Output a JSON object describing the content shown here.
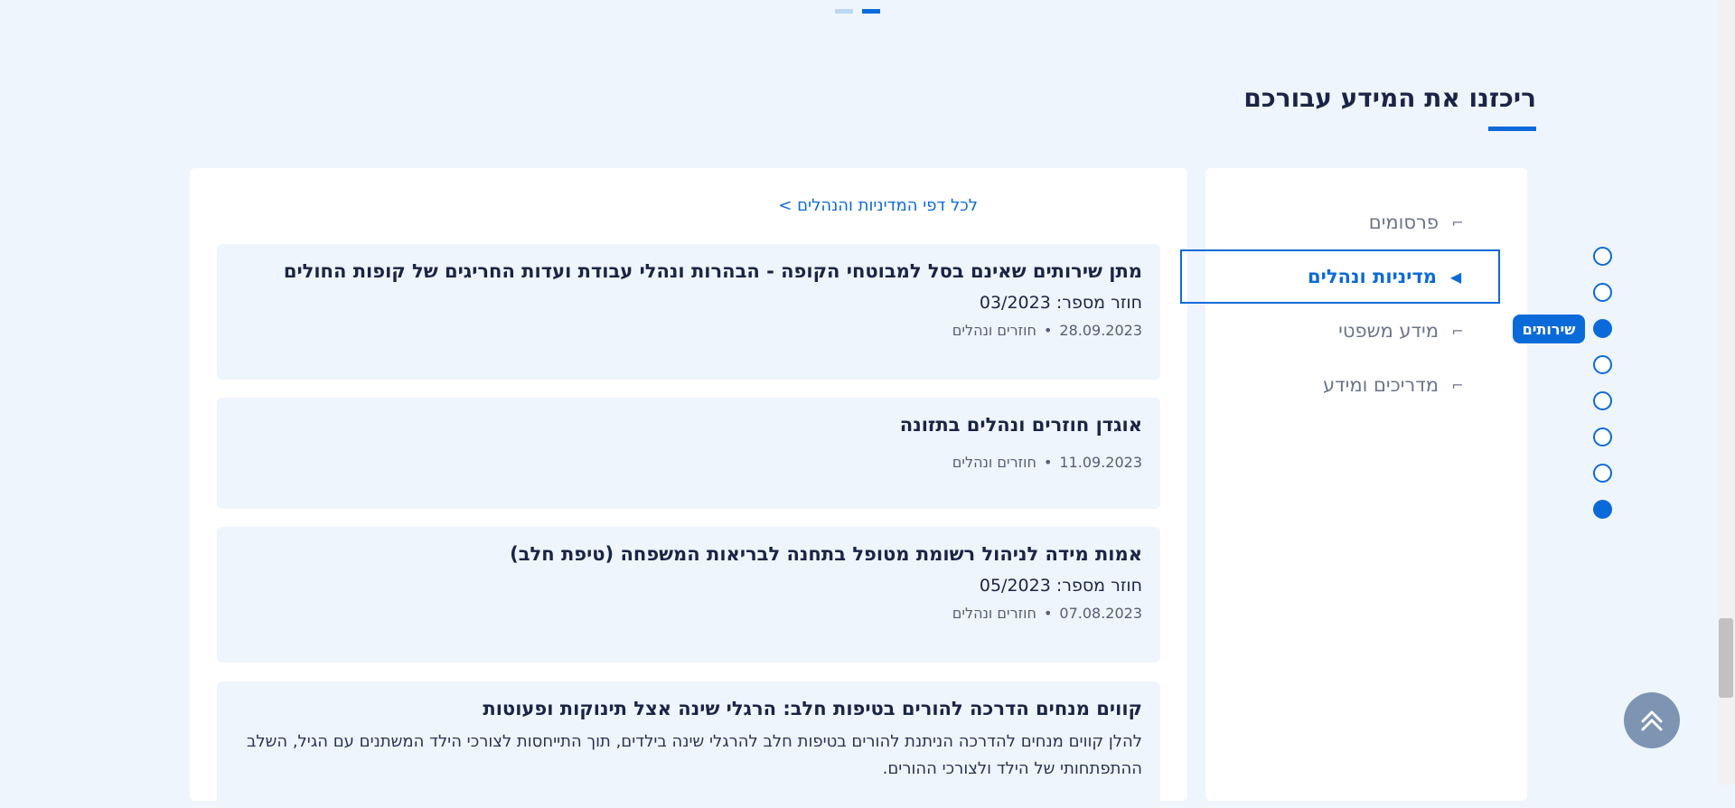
{
  "carousel": {
    "dots": 2,
    "active_index": 1
  },
  "section": {
    "title": "ריכזנו את המידע עבורכם"
  },
  "content": {
    "all_link": "לכל דפי המדיניות והנהלים >",
    "items": [
      {
        "title": "מתן שירותים שאינם בסל למבוטחי הקופה - הבהרות ונהלי עבודת ועדות החריגים של קופות החולים",
        "number": "חוזר מספר: 03/2023",
        "date": "28.09.2023",
        "category": "חוזרים ונהלים"
      },
      {
        "title": "אוגדן חוזרים ונהלים בתזונה",
        "date": "11.09.2023",
        "category": "חוזרים ונהלים"
      },
      {
        "title": "אמות מידה לניהול רשומת מטופל בתחנה לבריאות המשפחה (טיפת חלב)",
        "number": "חוזר מספר: 05/2023",
        "date": "07.08.2023",
        "category": "חוזרים ונהלים"
      },
      {
        "title": "קווים מנחים הדרכה להורים בטיפות חלב: הרגלי שינה אצל תינוקות ופעוטות",
        "description": "להלן קווים מנחים להדרכה הניתנת להורים בטיפות חלב להרגלי שינה בילדים, תוך התייחסות לצורכי הילד המשתנים עם הגיל, השלב ההתפתחותי של הילד ולצורכי ההורים."
      }
    ]
  },
  "nav": {
    "items": [
      {
        "label": "פרסומים",
        "icon": "corner-arrow-icon",
        "active": false
      },
      {
        "label": "מדיניות ונהלים",
        "icon": "triangle-left-icon",
        "active": true
      },
      {
        "label": "מידע משפטי",
        "icon": "corner-arrow-icon",
        "active": false
      },
      {
        "label": "מדריכים ומידע",
        "icon": "corner-arrow-icon",
        "active": false
      }
    ]
  },
  "page_nav": {
    "dots": 8,
    "filled_indices": [
      2,
      7
    ],
    "label": "שירותים"
  },
  "colors": {
    "accent": "#0b6ad9",
    "background": "#eef5fc",
    "text": "#1a2446"
  }
}
